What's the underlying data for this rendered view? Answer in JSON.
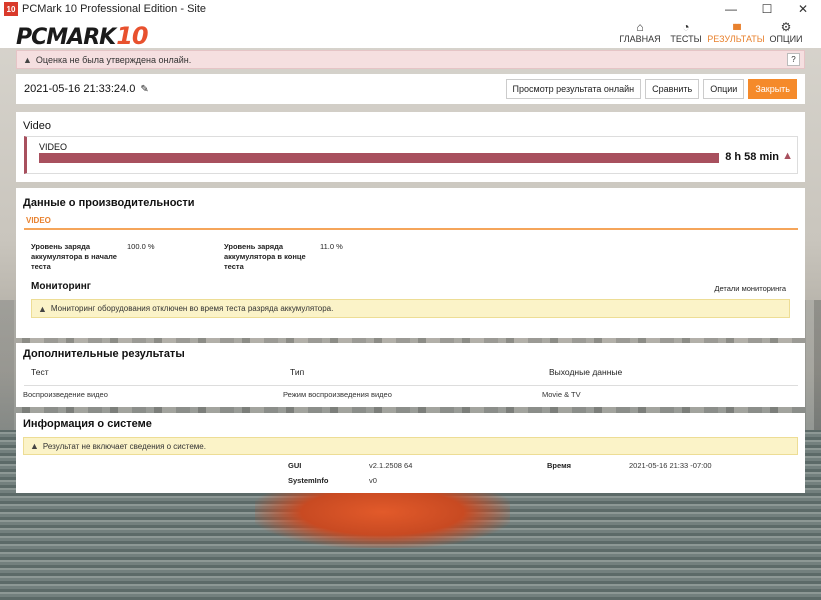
{
  "window": {
    "badge": "10",
    "title": "PCMark 10 Professional Edition - Site",
    "minimize": "—",
    "maximize": "☐",
    "close": "✕"
  },
  "header": {
    "logo_text": "PCMARK",
    "logo_num": "10",
    "nav": [
      {
        "label": "ГЛАВНАЯ",
        "icon": "home-icon",
        "glyph": "⌂"
      },
      {
        "label": "ТЕСТЫ",
        "icon": "gauge-icon",
        "glyph": "◔"
      },
      {
        "label": "РЕЗУЛЬТАТЫ",
        "icon": "bar-chart-icon",
        "glyph": "▮▮▮"
      },
      {
        "label": "ОПЦИИ",
        "icon": "gear-icon",
        "glyph": "⚙"
      }
    ],
    "active_color": "#e8812e"
  },
  "banner": {
    "text": "Оценка не была утверждена онлайн.",
    "help": "?"
  },
  "result": {
    "date": "2021-05-16 21:33:24.0",
    "buttons": {
      "view_online": "Просмотр результата онлайн",
      "compare": "Сравнить",
      "options": "Опции",
      "close": "Закрыть"
    }
  },
  "video": {
    "title": "Video",
    "label": "VIDEO",
    "score": "8 h 58 min",
    "bar_color": "#a8505e"
  },
  "performance": {
    "title": "Данные о производительности",
    "tab": "VIDEO",
    "battery_start_label": "Уровень заряда аккумулятора в начале теста",
    "battery_start_value": "100.0 %",
    "battery_end_label": "Уровень заряда аккумулятора в конце теста",
    "battery_end_value": "11.0 %",
    "monitoring_title": "Мониторинг",
    "monitoring_link": "Детали мониторинга",
    "monitoring_warning": "Мониторинг оборудования отключен во время теста разряда аккумулятора."
  },
  "extra": {
    "title": "Дополнительные результаты",
    "headers": [
      "Тест",
      "Тип",
      "Выходные данные"
    ],
    "row": [
      "Воспроизведение видео",
      "Режим воспроизведения видео",
      "Movie & TV"
    ]
  },
  "system": {
    "title": "Информация о системе",
    "warning": "Результат не включает сведения о системе.",
    "gui_label": "GUI",
    "gui_value": "v2.1.2508 64",
    "time_label": "Время",
    "time_value": "2021-05-16 21:33 -07:00",
    "sysinfo_label": "SystemInfo",
    "sysinfo_value": "v0"
  }
}
